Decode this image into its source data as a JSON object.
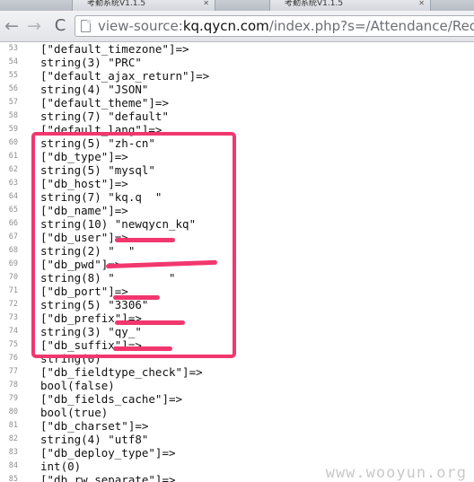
{
  "browser": {
    "tabs": [
      {
        "title": "考勤系统V1.1.5"
      },
      {
        "title": "考勤系统V1.1.5"
      }
    ],
    "nav": {
      "back": "←",
      "forward": "→",
      "reload": "C"
    },
    "url": {
      "prefix": "view-source:",
      "host": "kq.qycn.com",
      "path": "/index.php?s=/Attendance/Record/"
    }
  },
  "source_lines": [
    {
      "n": "53",
      "text": "[\"default_timezone\"]=>"
    },
    {
      "n": "54",
      "text": "string(3) \"PRC\""
    },
    {
      "n": "55",
      "text": "[\"default_ajax_return\"]=>"
    },
    {
      "n": "56",
      "text": "string(4) \"JSON\""
    },
    {
      "n": "57",
      "text": "[\"default_theme\"]=>"
    },
    {
      "n": "58",
      "text": "string(7) \"default\""
    },
    {
      "n": "59",
      "text": "[\"default_lang\"]=>"
    },
    {
      "n": "60",
      "text": "string(5) \"zh-cn\""
    },
    {
      "n": "61",
      "text": "[\"db_type\"]=>"
    },
    {
      "n": "62",
      "text": "string(5) \"mysql\""
    },
    {
      "n": "63",
      "text": "[\"db_host\"]=>"
    },
    {
      "n": "64",
      "text": "string(7) \"kq.q  \""
    },
    {
      "n": "65",
      "text": "[\"db_name\"]=>"
    },
    {
      "n": "66",
      "text": "string(10) \"newqycn_kq\""
    },
    {
      "n": "67",
      "text": "[\"db_user\"]=>"
    },
    {
      "n": "68",
      "text": "string(2) \"  \""
    },
    {
      "n": "69",
      "text": "[\"db_pwd\"]=>"
    },
    {
      "n": "70",
      "text": "string(8) \"        \""
    },
    {
      "n": "71",
      "text": "[\"db_port\"]=>"
    },
    {
      "n": "72",
      "text": "string(5) \"3306\""
    },
    {
      "n": "73",
      "text": "[\"db_prefix\"]=>"
    },
    {
      "n": "74",
      "text": "string(3) \"qy_\""
    },
    {
      "n": "75",
      "text": "[\"db_suffix\"]=>"
    },
    {
      "n": "76",
      "text": "string(0) \"\""
    },
    {
      "n": "77",
      "text": "[\"db_fieldtype_check\"]=>"
    },
    {
      "n": "78",
      "text": "bool(false)"
    },
    {
      "n": "79",
      "text": "[\"db_fields_cache\"]=>"
    },
    {
      "n": "80",
      "text": "bool(true)"
    },
    {
      "n": "81",
      "text": "[\"db_charset\"]=>"
    },
    {
      "n": "82",
      "text": "string(4) \"utf8\""
    },
    {
      "n": "83",
      "text": "[\"db_deploy_type\"]=>"
    },
    {
      "n": "84",
      "text": "int(0)"
    },
    {
      "n": "85",
      "text": "[\"db_rw_separate\"]=>"
    }
  ],
  "annotation": {
    "color": "#f1376e"
  },
  "watermark": "www.wooyun.org"
}
